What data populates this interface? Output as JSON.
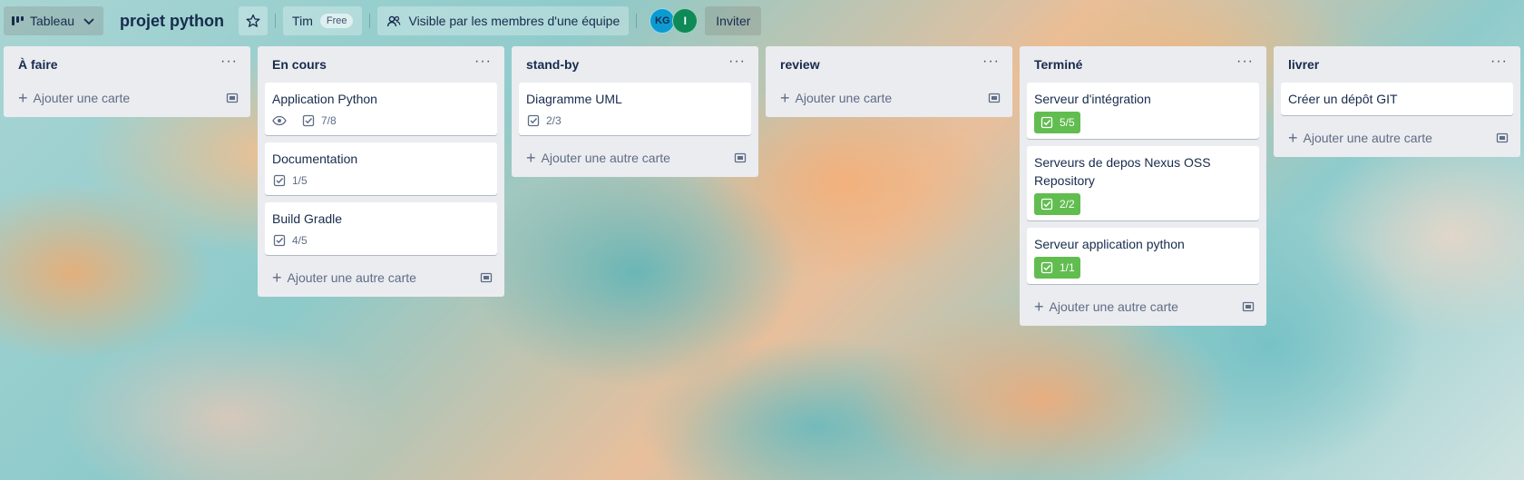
{
  "header": {
    "view_label": "Tableau",
    "board_title": "projet python",
    "workspace_name": "Tim",
    "workspace_badge": "Free",
    "visibility_label": "Visible par les membres d'une équipe",
    "avatars": [
      {
        "initials": "KG",
        "color": "#0c9bd0"
      },
      {
        "initials": "I",
        "color": "#0e8a56"
      }
    ],
    "invite_label": "Inviter"
  },
  "lists": [
    {
      "title": "À faire",
      "cards": [],
      "add_label": "Ajouter une carte"
    },
    {
      "title": "En cours",
      "cards": [
        {
          "title": "Application Python",
          "watch": true,
          "checklist": "7/8",
          "complete": false
        },
        {
          "title": "Documentation",
          "checklist": "1/5",
          "complete": false
        },
        {
          "title": "Build Gradle",
          "checklist": "4/5",
          "complete": false
        }
      ],
      "add_label": "Ajouter une autre carte"
    },
    {
      "title": "stand-by",
      "cards": [
        {
          "title": "Diagramme UML",
          "checklist": "2/3",
          "complete": false
        }
      ],
      "add_label": "Ajouter une autre carte"
    },
    {
      "title": "review",
      "cards": [],
      "add_label": "Ajouter une carte"
    },
    {
      "title": "Terminé",
      "cards": [
        {
          "title": "Serveur d'intégration",
          "checklist": "5/5",
          "complete": true
        },
        {
          "title": "Serveurs de depos Nexus OSS Repository",
          "checklist": "2/2",
          "complete": true
        },
        {
          "title": "Serveur application python",
          "checklist": "1/1",
          "complete": true
        }
      ],
      "add_label": "Ajouter une autre carte"
    },
    {
      "title": "livrer",
      "cards": [
        {
          "title": "Créer un dépôt GIT"
        }
      ],
      "add_label": "Ajouter une autre carte"
    }
  ],
  "colors": {
    "list_bg": "#ebecf0",
    "complete_badge": "#61bd4f",
    "text": "#172b4d"
  },
  "icons": [
    "board-icon",
    "chevron-down-icon",
    "star-icon",
    "team-visibility-icon",
    "eye-icon",
    "checklist-icon",
    "template-icon",
    "plus-icon",
    "more-icon"
  ]
}
